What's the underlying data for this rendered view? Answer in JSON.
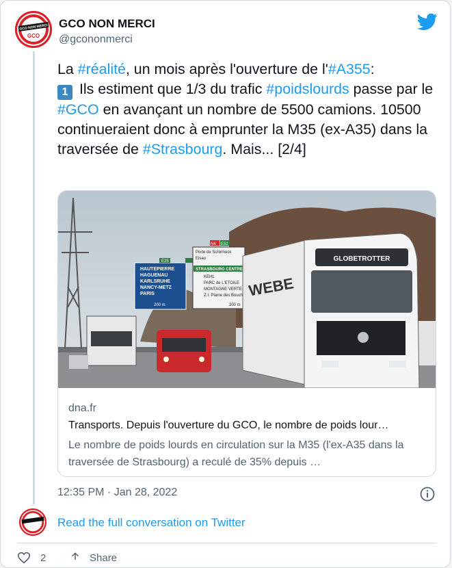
{
  "tweet": {
    "author_name": "GCO NON MERCI",
    "author_handle": "@gcononmerci",
    "avatar_text_top": "GCO NON MERCI",
    "avatar_text_bottom": "GCO",
    "text": {
      "t1": "La ",
      "h1": "#réalité",
      "t2": ", un mois après l'ouverture de l'",
      "h2": "#A355",
      "t3": ":",
      "keycap": "1",
      "t4": " Ils estiment que 1/3 du trafic ",
      "h3": "#poidslourds",
      "t5": " passe par le ",
      "h4": "#GCO",
      "t6": " en avançant un nombre de 5500 camions. 10500 continueraient donc à emprunter la M35 (ex-A35) dans la traversée de ",
      "h5": "#Strasbourg",
      "t7": ". Mais... [2/4]"
    },
    "link_card": {
      "domain": "dna.fr",
      "title": "Transports. Depuis l'ouverture du GCO, le nombre de poids lour…",
      "description": "Le nombre de poids lourds en circulation sur la M35 (l'ex-A35 dans la traversée de Strasbourg) a reculé de 35% depuis …",
      "photo_signs": {
        "sign_left": [
          "HAUTEPIERRE",
          "HAGUENAU",
          "KARLSRUHE",
          "NANCY-METZ",
          "PARIS"
        ],
        "sign_left_dist": "200 m",
        "sign_right": [
          "Porte de Schirmeck",
          "Elsau",
          "STRASBOURG CENTRE",
          "KEHL",
          "PARC de L'ETOILE",
          "MONTAGNE VERTE",
          "Z.I. Plaine des Bouchers"
        ],
        "sign_right_dist": "200 m",
        "truck_brand": "GLOBETROTTER",
        "route_badges": [
          "N4",
          "E52",
          "E25"
        ]
      }
    },
    "timestamp": "12:35 PM · Jan 28, 2022",
    "read_more": "Read the full conversation on Twitter",
    "actions": {
      "likes": "2",
      "share": "Share"
    }
  },
  "colors": {
    "accent": "#1d9bf0",
    "avatar_red": "#d9232a",
    "muted": "#536471"
  }
}
